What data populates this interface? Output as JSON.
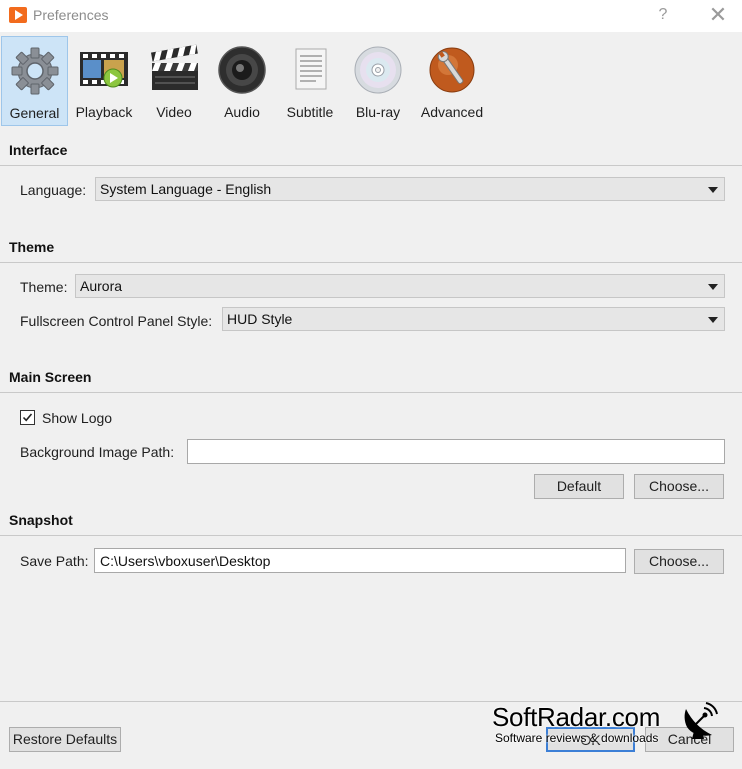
{
  "window": {
    "title": "Preferences",
    "help_glyph": "?",
    "close_glyph": "✕"
  },
  "tabs": [
    {
      "id": "general",
      "label": "General",
      "icon": "gear-icon",
      "selected": true
    },
    {
      "id": "playback",
      "label": "Playback",
      "icon": "film-strip-icon",
      "selected": false
    },
    {
      "id": "video",
      "label": "Video",
      "icon": "clapperboard-icon",
      "selected": false
    },
    {
      "id": "audio",
      "label": "Audio",
      "icon": "speaker-icon",
      "selected": false
    },
    {
      "id": "subtitle",
      "label": "Subtitle",
      "icon": "document-icon",
      "selected": false
    },
    {
      "id": "bluray",
      "label": "Blu-ray",
      "icon": "disc-icon",
      "selected": false
    },
    {
      "id": "advanced",
      "label": "Advanced",
      "icon": "globe-wrench-icon",
      "selected": false
    }
  ],
  "interface": {
    "title": "Interface",
    "language_label": "Language:",
    "language_value": "System Language - English"
  },
  "theme": {
    "title": "Theme",
    "theme_label": "Theme:",
    "theme_value": "Aurora",
    "fullscreen_label": "Fullscreen Control Panel Style:",
    "fullscreen_value": "HUD Style"
  },
  "main_screen": {
    "title": "Main Screen",
    "show_logo_label": "Show Logo",
    "show_logo_checked": true,
    "bg_path_label": "Background Image Path:",
    "bg_path_value": "",
    "default_button": "Default",
    "choose_button": "Choose..."
  },
  "snapshot": {
    "title": "Snapshot",
    "save_path_label": "Save Path:",
    "save_path_value": "C:\\Users\\vboxuser\\Desktop",
    "choose_button": "Choose..."
  },
  "footer": {
    "restore_button": "Restore Defaults",
    "ok_button": "OK",
    "cancel_button": "Cancel"
  },
  "watermark": {
    "main": "SoftRadar.com",
    "sub": "Software reviews & downloads"
  },
  "colors": {
    "selected_tab_bg": "#cde4f7",
    "selected_tab_border": "#9ec6ea",
    "ok_focus_border": "#3c7fd6",
    "app_icon_orange": "#f26b1d"
  }
}
